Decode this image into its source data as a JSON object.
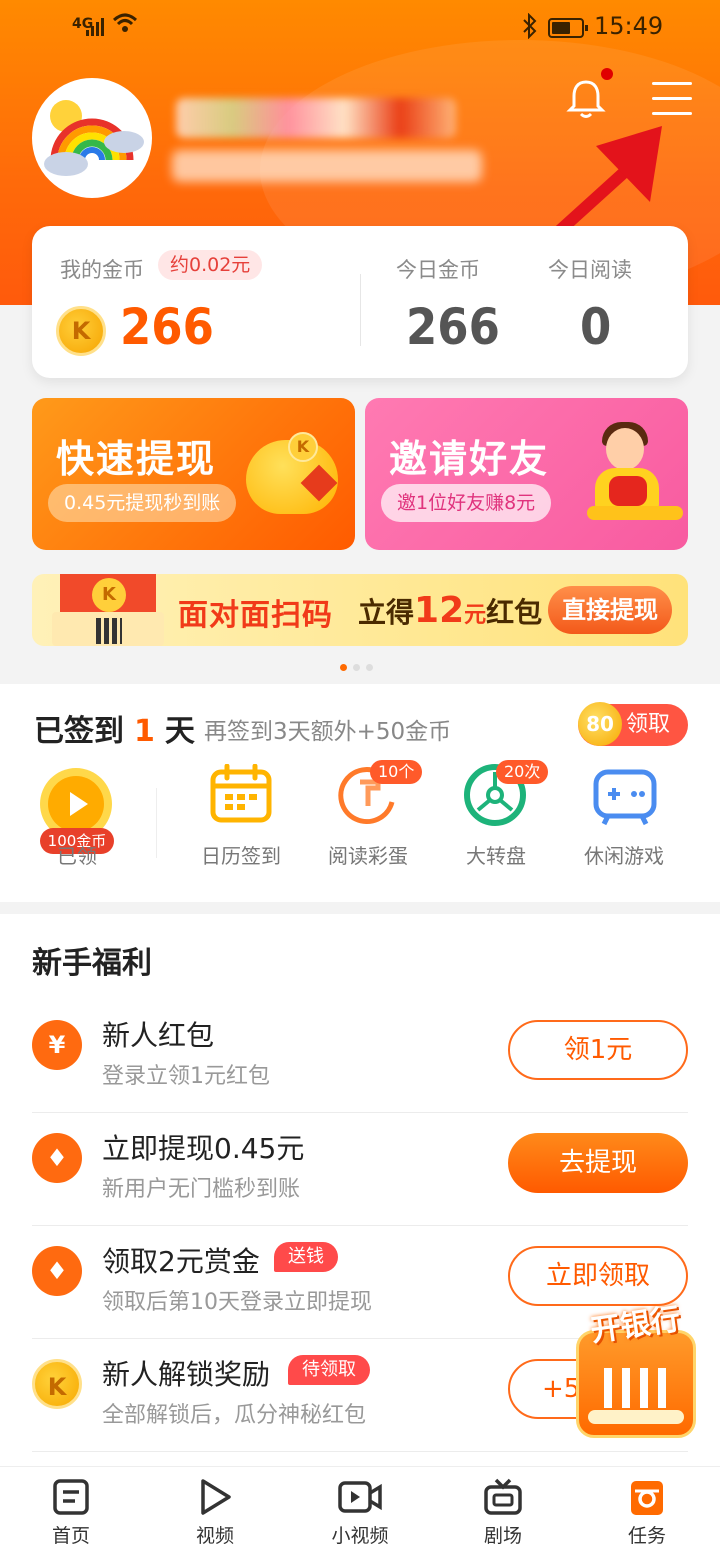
{
  "status_bar": {
    "network": "4G",
    "time": "15:49"
  },
  "header": {
    "notification_icon": "bell-icon",
    "menu_icon": "hamburger-menu-icon"
  },
  "coin_card": {
    "my_coins_label": "我的金币",
    "approx_value": "约0.02元",
    "my_coins": "266",
    "today_coins_label": "今日金币",
    "today_coins": "266",
    "today_read_label": "今日阅读",
    "today_read": "0",
    "coin_symbol": "K"
  },
  "banners": [
    {
      "title": "快速提现",
      "pill": "0.45元提现秒到账"
    },
    {
      "title": "邀请好友",
      "pill": "邀1位好友赚8元"
    }
  ],
  "promo": {
    "text1": "面对面扫码",
    "text2_prefix": "立得",
    "amount": "12",
    "unit": "元",
    "text2_suffix": "红包",
    "button": "直接提现"
  },
  "carousel": {
    "total": 3,
    "active": 1
  },
  "sign_in": {
    "prefix": "已签到",
    "days": "1",
    "suffix": "天",
    "hint": "再签到3天额外+50金币",
    "claim_coins": "80",
    "claim_label": "领取",
    "tiles": [
      {
        "label": "已领",
        "badge": "100金币",
        "icon": "play-coin-icon"
      },
      {
        "label": "日历签到",
        "badge": "",
        "icon": "calendar-icon"
      },
      {
        "label": "阅读彩蛋",
        "badge": "10个",
        "icon": "easter-egg-icon"
      },
      {
        "label": "大转盘",
        "badge": "20次",
        "icon": "wheel-icon"
      },
      {
        "label": "休闲游戏",
        "badge": "",
        "icon": "gamepad-icon"
      }
    ]
  },
  "welfare": {
    "title": "新手福利",
    "items": [
      {
        "title": "新人红包",
        "sub": "登录立领1元红包",
        "tag": "",
        "button": "领1元",
        "icon_char": "¥"
      },
      {
        "title": "立即提现0.45元",
        "sub": "新用户无门槛秒到账",
        "tag": "",
        "button": "去提现",
        "icon_char": "♦"
      },
      {
        "title": "领取2元赏金",
        "sub": "领取后第10天登录立即提现",
        "tag": "送钱",
        "button": "立即领取",
        "icon_char": "♦"
      },
      {
        "title": "新人解锁奖励",
        "sub": "全部解锁后，瓜分神秘红包",
        "tag": "待领取",
        "button": "+5",
        "icon_char": "K"
      }
    ]
  },
  "floating_badge": {
    "title": "开银行"
  },
  "tabbar": [
    {
      "label": "首页",
      "icon": "home-doc-icon"
    },
    {
      "label": "视频",
      "icon": "play-icon"
    },
    {
      "label": "小视频",
      "icon": "video-camera-icon"
    },
    {
      "label": "剧场",
      "icon": "tv-icon"
    },
    {
      "label": "任务",
      "icon": "task-icon"
    }
  ],
  "colors": {
    "brand": "#ff6a00",
    "accent_red": "#ff4a4a",
    "pink": "#f85ba0"
  }
}
